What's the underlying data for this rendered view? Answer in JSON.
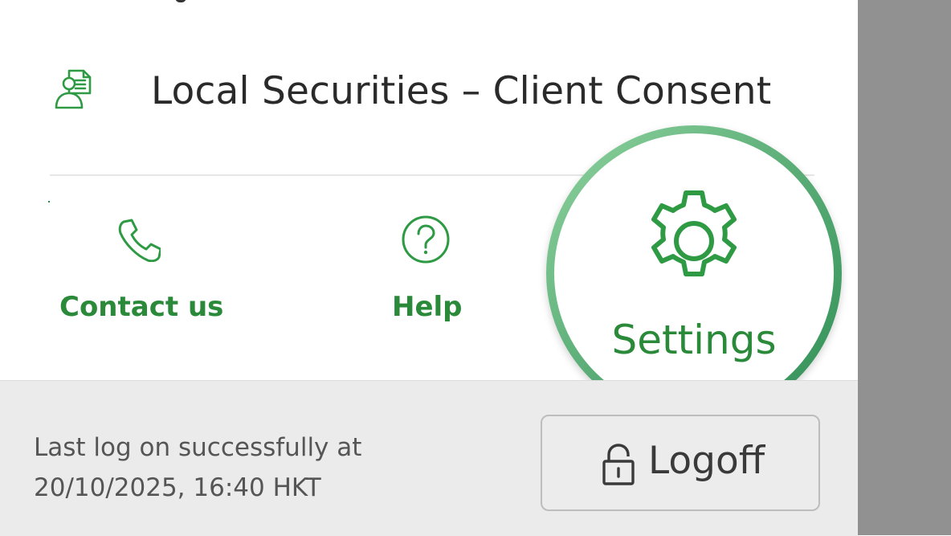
{
  "menu": {
    "items": [
      {
        "label": "Local Securities – Client Consent",
        "icon": "document-person-icon"
      }
    ]
  },
  "quick_actions": [
    {
      "label": "Contact us",
      "icon": "phone-icon"
    },
    {
      "label": "Help",
      "icon": "help-icon"
    },
    {
      "label": "Settings",
      "icon": "gear-icon",
      "highlighted": true
    }
  ],
  "footer": {
    "last_log_line1": "Last log on successfully at",
    "last_log_line2": "20/10/2025, 16:40 HKT",
    "logoff_label": "Logoff",
    "logoff_icon": "unlock-icon"
  },
  "colors": {
    "accent_green": "#2a8a3a",
    "footer_bg": "#ebebeb",
    "overlay_gray": "#919191"
  }
}
